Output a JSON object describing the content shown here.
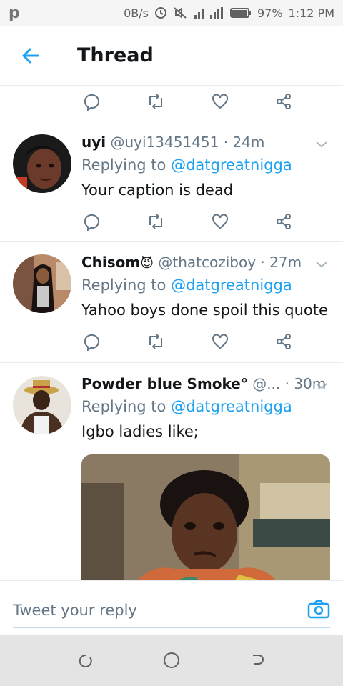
{
  "status_bar": {
    "logo": "p",
    "net_speed": "0B/s",
    "battery": "97%",
    "time": "1:12 PM"
  },
  "header": {
    "title": "Thread"
  },
  "tweets": [
    {
      "name": "uyi",
      "handle": "@uyi13451451",
      "dot": "·",
      "time": "24m",
      "replying_prefix": "Replying to ",
      "replying_to": "@datgreatnigga",
      "text": "Your caption is dead"
    },
    {
      "name": "Chisom",
      "emoji": "😈",
      "handle": "@thatcoziboy",
      "dot": "·",
      "time": "27m",
      "replying_prefix": "Replying to ",
      "replying_to": "@datgreatnigga",
      "text": "Yahoo boys done spoil this quote"
    },
    {
      "name": "Powder blue Smoke°",
      "handle": "@...",
      "dot": "·",
      "time": "30m",
      "replying_prefix": "Replying to ",
      "replying_to": "@datgreatnigga",
      "text": "Igbo ladies like;"
    }
  ],
  "reply_bar": {
    "placeholder": "Tweet your reply"
  },
  "colors": {
    "accent": "#1da1f2",
    "secondary_text": "#657786",
    "divider": "#e6ecf0"
  },
  "icons": [
    "back-arrow-icon",
    "reply-icon",
    "retweet-icon",
    "like-icon",
    "share-icon",
    "chevron-down-icon",
    "camera-icon",
    "recents-icon",
    "home-icon",
    "back-nav-icon"
  ]
}
